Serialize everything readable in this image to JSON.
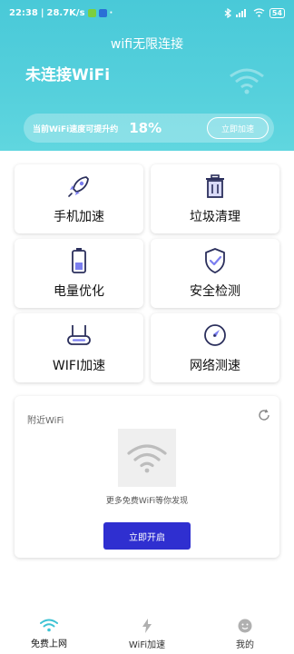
{
  "status_bar": {
    "time": "22:38",
    "net_speed": "28.7K/s",
    "dot": "·",
    "battery": "54"
  },
  "header": {
    "app_title": "wifi无限连接",
    "connection_status": "未连接WiFi",
    "speed_text": "当前WiFi速度可提升约",
    "speed_percent": "18%",
    "speed_button": "立即加速"
  },
  "features": [
    {
      "label": "手机加速",
      "icon": "rocket-icon"
    },
    {
      "label": "垃圾清理",
      "icon": "trash-icon"
    },
    {
      "label": "电量优化",
      "icon": "battery-icon"
    },
    {
      "label": "安全检测",
      "icon": "shield-check-icon"
    },
    {
      "label": "WIFI加速",
      "icon": "router-icon"
    },
    {
      "label": "网络测速",
      "icon": "speedometer-icon"
    }
  ],
  "nearby": {
    "title": "附近WiFi",
    "description": "更多免费WiFi等你发现",
    "button": "立即开启"
  },
  "bottom_nav": [
    {
      "label": "免费上网",
      "icon": "wifi-icon",
      "active": true
    },
    {
      "label": "WiFi加速",
      "icon": "lightning-icon",
      "active": false
    },
    {
      "label": "我的",
      "icon": "profile-icon",
      "active": false
    }
  ],
  "colors": {
    "header_accent": "#4fccd9",
    "primary_button": "#2f2fd0",
    "icon_dark": "#2b2f5c"
  }
}
